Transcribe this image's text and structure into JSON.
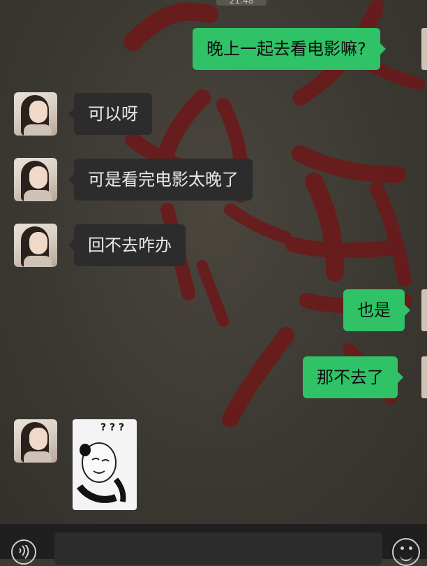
{
  "chat": {
    "timestamp": "21:48",
    "messages": [
      {
        "side": "right",
        "text": "晚上一起去看电影嘛?"
      },
      {
        "side": "left",
        "text": "可以呀"
      },
      {
        "side": "left",
        "text": "可是看完电影太晚了"
      },
      {
        "side": "left",
        "text": "回不去咋办"
      },
      {
        "side": "right",
        "text": "也是"
      },
      {
        "side": "right",
        "text": "那不去了"
      },
      {
        "side": "left",
        "sticker": "panda-confused-sticker",
        "text": "? ? ?"
      }
    ]
  },
  "input_bar": {
    "placeholder": "",
    "voice_icon": "voice-icon",
    "emoji_icon": "emoji-icon"
  },
  "colors": {
    "outgoing_bubble": "#2fc266",
    "incoming_bubble": "#2c2c2c",
    "background": "#3d3a34"
  }
}
